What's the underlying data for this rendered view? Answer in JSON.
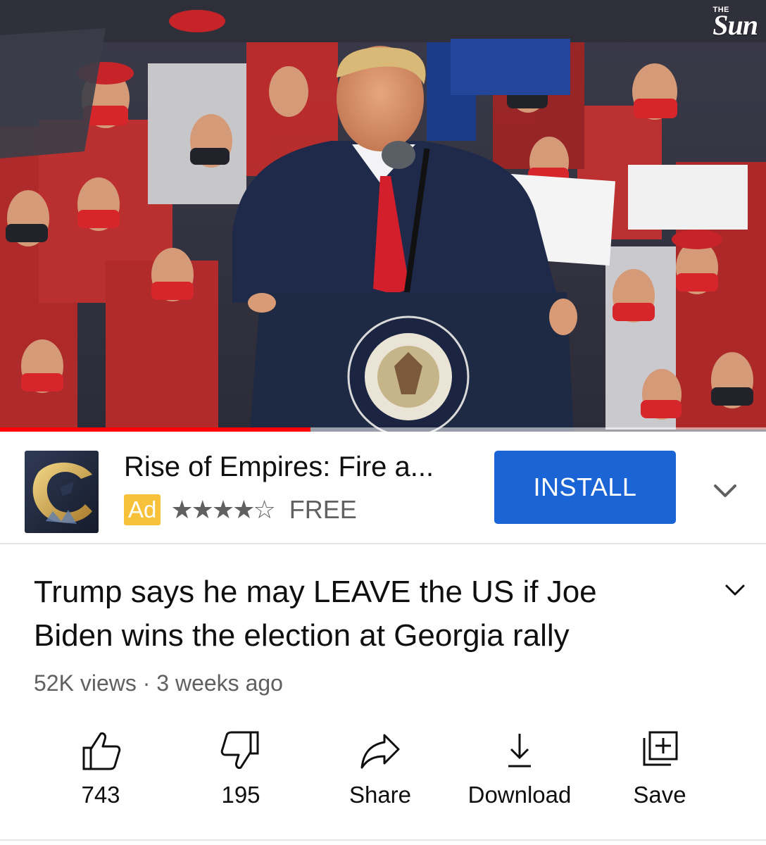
{
  "video": {
    "channel_logo_top": "THE",
    "channel_logo": "Sun",
    "progress_fraction": 0.405
  },
  "ad": {
    "title": "Rise of Empires: Fire a...",
    "badge": "Ad",
    "stars": "★★★★☆",
    "price": "FREE",
    "install_label": "INSTALL",
    "accent_color": "#1a64d6",
    "badge_color": "#f7c23a"
  },
  "details": {
    "title": "Trump says he may LEAVE the US if Joe Biden wins the election at Georgia rally",
    "meta": "52K views · 3 weeks ago"
  },
  "actions": {
    "like_count": "743",
    "dislike_count": "195",
    "share_label": "Share",
    "download_label": "Download",
    "save_label": "Save"
  },
  "icons": [
    "thumbs-up-icon",
    "thumbs-down-icon",
    "share-icon",
    "download-icon",
    "save-to-playlist-icon",
    "chevron-down-icon"
  ]
}
